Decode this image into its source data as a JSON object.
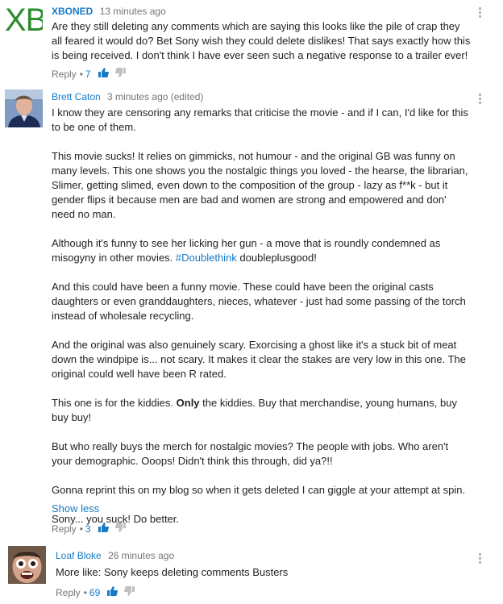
{
  "comments": [
    {
      "avatar_text": "XB",
      "author": "XBONED",
      "time": "13 minutes ago",
      "text": "Are they still deleting any comments which are saying this looks like the pile of crap they all feared it would do? Bet Sony wish they could delete dislikes! That says exactly how this is being received. I don't think I have ever seen such a negative response to a trailer ever!",
      "reply_label": "Reply",
      "dot": "•",
      "likes": "7"
    },
    {
      "author": "Brett Caton",
      "time": "3 minutes ago (edited)",
      "paragraphs": [
        "I know they are censoring any remarks that criticise the movie - and if I can, I'd like for this to be one of them.",
        "This movie sucks! It relies on gimmicks, not humour - and the original GB was funny on many levels. This one shows you the nostalgic things you loved - the hearse, the librarian, Slimer, getting slimed, even down to the composition of the group - lazy as f**k - but it gender flips it because men are bad and women are strong and empowered and don' need no man.",
        "Although it's funny to see her licking her gun - a move that is roundly condemned as misogyny in other movies. ",
        "And this could have been a funny movie. These could have been the original casts daughters or even granddaughters, nieces, whatever - just had some passing of the torch instead of wholesale recycling.",
        "And the original was also genuinely scary. Exorcising a ghost like it's a stuck bit of meat down the windpipe is... not scary. It makes it clear the stakes are very low in this one. The original could well have been R rated.",
        "This one is for the kiddies. ",
        "But who really buys the merch for nostalgic movies? The people with jobs. Who aren't your demographic. Ooops! Didn't think this through, did ya?!!",
        "Gonna reprint this on my blog so when it gets deleted I can giggle at your attempt at spin.",
        "Sony... you suck! Do better."
      ],
      "hashtag": "#Doublethink",
      "hashtag_tail": " doubleplusgood!",
      "bold_word": "Only",
      "bold_tail": " the kiddies. Buy that merchandise, young humans, buy buy buy!",
      "show_less": "Show less",
      "reply_label": "Reply",
      "dot": "•",
      "likes": "3"
    },
    {
      "author": "Loaf Bloke",
      "time": "26 minutes ago",
      "text": "More like: Sony keeps deleting comments Busters",
      "reply_label": "Reply",
      "dot": "•",
      "likes": "69"
    }
  ],
  "colors": {
    "link": "#167ac6",
    "meta": "#767676",
    "text": "#222222"
  },
  "icons": [
    "thumbs-up-icon",
    "thumbs-down-icon",
    "more-vert-icon"
  ]
}
